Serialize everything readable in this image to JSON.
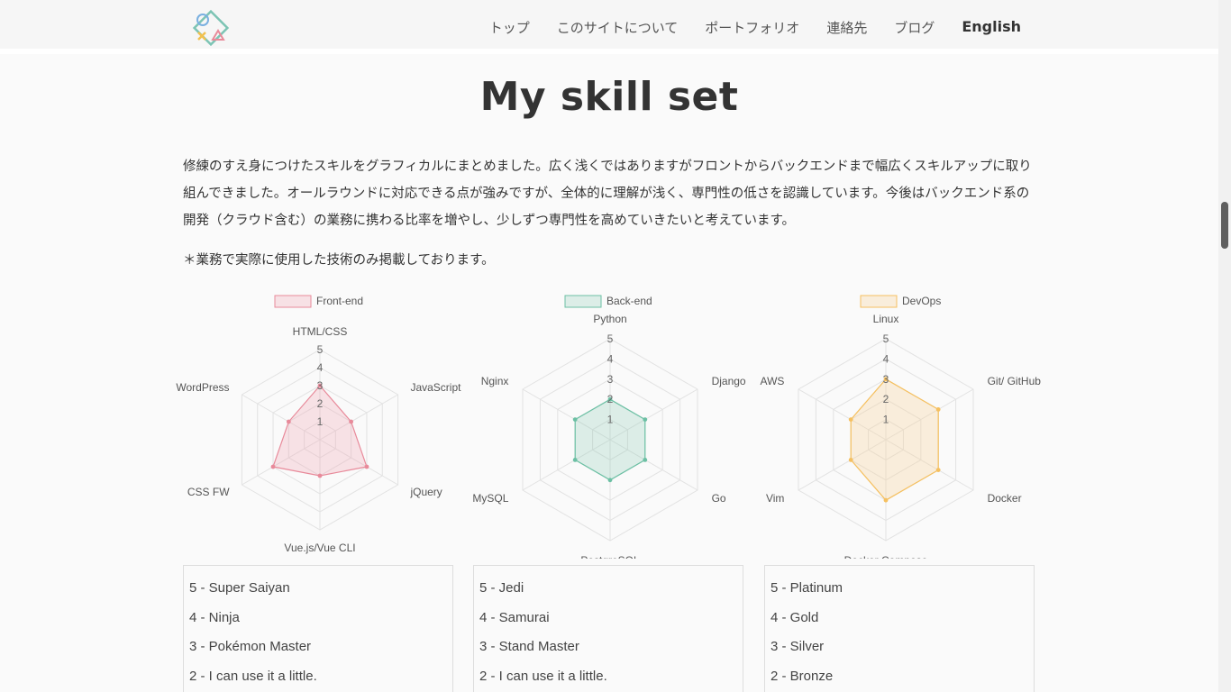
{
  "nav": {
    "items": [
      "トップ",
      "このサイトについて",
      "ポートフォリオ",
      "連絡先",
      "ブログ"
    ],
    "language": "English"
  },
  "page": {
    "title": "My skill set",
    "intro": "修練のすえ身につけたスキルをグラフィカルにまとめました。広く浅くではありますがフロントからバックエンドまで幅広くスキルアップに取り組んできました。オールラウンドに対応できる点が強みですが、全体的に理解が浅く、専門性の低さを認識しています。今後はバックエンド系の開発（クラウド含む）の業務に携わる比率を増やし、少しずつ専門性を高めていきたいと考えています。",
    "note": "＊業務で実際に使用した技術のみ掲載しております。"
  },
  "chart_data": [
    {
      "type": "radar",
      "legend": "Front-end",
      "color": "#e88a9a",
      "fill": "rgba(240,160,175,0.28)",
      "labels": [
        "HTML/CSS",
        "JavaScript",
        "jQuery",
        "Vue.js/Vue CLI",
        "CSS FW",
        "WordPress"
      ],
      "values": [
        3,
        2,
        3,
        2,
        3,
        2
      ],
      "ticks": [
        1,
        2,
        3,
        4,
        5
      ],
      "rmax": 5
    },
    {
      "type": "radar",
      "legend": "Back-end",
      "color": "#6cc0a4",
      "fill": "rgba(130,200,175,0.25)",
      "labels": [
        "Python",
        "Django",
        "Go",
        "PostgreSQL",
        "MySQL",
        "Nginx"
      ],
      "values": [
        2,
        2,
        2,
        2,
        2,
        2
      ],
      "ticks": [
        1,
        2,
        3,
        4,
        5
      ],
      "rmax": 5
    },
    {
      "type": "radar",
      "legend": "DevOps",
      "color": "#f5c060",
      "fill": "rgba(250,210,150,0.3)",
      "labels": [
        "Linux",
        "Git/ GitHub",
        "Docker",
        "Docker Compose",
        "Vim",
        "AWS"
      ],
      "values": [
        3,
        3,
        3,
        3,
        2,
        2
      ],
      "ticks": [
        1,
        2,
        3,
        4,
        5
      ],
      "rmax": 5
    }
  ],
  "levels": [
    [
      "5 - Super Saiyan",
      "4 - Ninja",
      "3 - Pokémon Master",
      "2 - I can use it a little."
    ],
    [
      "5 - Jedi",
      "4 - Samurai",
      "3 - Stand Master",
      "2 - I can use it a little."
    ],
    [
      "5 - Platinum",
      "4 - Gold",
      "3 - Silver",
      "2 - Bronze"
    ]
  ]
}
